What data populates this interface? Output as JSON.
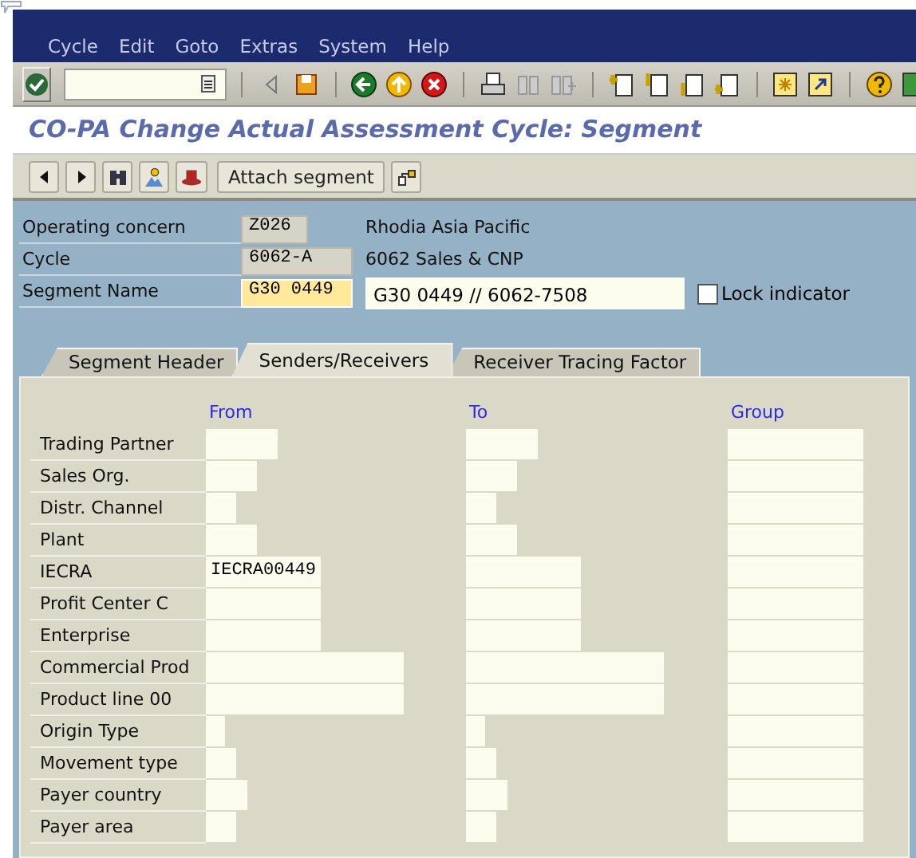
{
  "menu": [
    "Cycle",
    "Edit",
    "Goto",
    "Extras",
    "System",
    "Help"
  ],
  "title": "CO-PA Change Actual Assessment Cycle: Segment",
  "app_toolbar": {
    "button": "Attach segment"
  },
  "header": {
    "fields": [
      {
        "label": "Operating concern",
        "value": "Z026",
        "description": "Rhodia Asia Pacific",
        "kind": "display"
      },
      {
        "label": "Cycle",
        "value": "6062-A",
        "description": "6062 Sales & CNP",
        "kind": "display"
      },
      {
        "label": "Segment Name",
        "value": "G30 0449",
        "description": "G30 0449 // 6062-7508",
        "kind": "input"
      }
    ],
    "lock": {
      "label": "Lock indicator",
      "checked": false
    }
  },
  "tabs": [
    {
      "label": "Segment Header",
      "selected": false
    },
    {
      "label": "Senders/Receivers",
      "selected": true
    },
    {
      "label": "Receiver Tracing Factor",
      "selected": false
    }
  ],
  "grid": {
    "columns": [
      "From",
      "To",
      "Group"
    ],
    "rows": [
      {
        "label": "Trading Partner"
      },
      {
        "label": "Sales Org."
      },
      {
        "label": "Distr. Channel"
      },
      {
        "label": "Plant"
      },
      {
        "label": "IECRA",
        "from": "IECRA00449"
      },
      {
        "label": "Profit Center C"
      },
      {
        "label": "Enterprise"
      },
      {
        "label": "Commercial Prod"
      },
      {
        "label": "Product line 00"
      },
      {
        "label": "Origin Type"
      },
      {
        "label": "Movement type"
      },
      {
        "label": "Payer country"
      },
      {
        "label": "Payer area"
      }
    ]
  }
}
